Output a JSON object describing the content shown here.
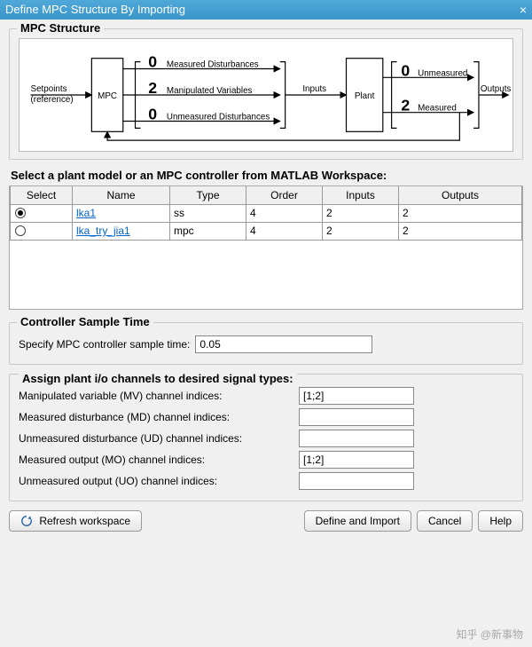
{
  "window": {
    "title": "Define MPC Structure By Importing",
    "close": "×"
  },
  "structure": {
    "group_label": "MPC Structure",
    "setpoints_line1": "Setpoints",
    "setpoints_line2": "(reference)",
    "mpc": "MPC",
    "plant": "Plant",
    "inputs": "Inputs",
    "outputs": "Outputs",
    "md": {
      "count": "0",
      "label": "Measured Disturbances"
    },
    "mv": {
      "count": "2",
      "label": "Manipulated Variables"
    },
    "ud": {
      "count": "0",
      "label": "Unmeasured Disturbances"
    },
    "um": {
      "count": "0",
      "label": "Unmeasured"
    },
    "mo": {
      "count": "2",
      "label": "Measured"
    }
  },
  "select": {
    "heading": "Select a plant model or an MPC controller from MATLAB Workspace:",
    "cols": {
      "select": "Select",
      "name": "Name",
      "type": "Type",
      "order": "Order",
      "inputs": "Inputs",
      "outputs": "Outputs"
    },
    "rows": [
      {
        "selected": true,
        "name": "lka1",
        "type": "ss",
        "order": "4",
        "inputs": "2",
        "outputs": "2"
      },
      {
        "selected": false,
        "name": "lka_try_jia1",
        "type": "mpc",
        "order": "4",
        "inputs": "2",
        "outputs": "2"
      }
    ]
  },
  "sample": {
    "group_label": "Controller Sample Time",
    "label": "Specify MPC controller sample time:",
    "value": "0.05"
  },
  "assign": {
    "heading": "Assign plant i/o channels to desired signal types:",
    "mv": {
      "label": "Manipulated variable (MV) channel indices:",
      "value": "[1;2]"
    },
    "md": {
      "label": "Measured disturbance (MD) channel indices:",
      "value": ""
    },
    "ud": {
      "label": "Unmeasured disturbance (UD) channel indices:",
      "value": ""
    },
    "mo": {
      "label": "Measured output (MO) channel indices:",
      "value": "[1;2]"
    },
    "uo": {
      "label": "Unmeasured output (UO) channel indices:",
      "value": ""
    }
  },
  "buttons": {
    "refresh": "Refresh workspace",
    "define": "Define and Import",
    "cancel": "Cancel",
    "help": "Help"
  },
  "watermark": "知乎 @新事物"
}
